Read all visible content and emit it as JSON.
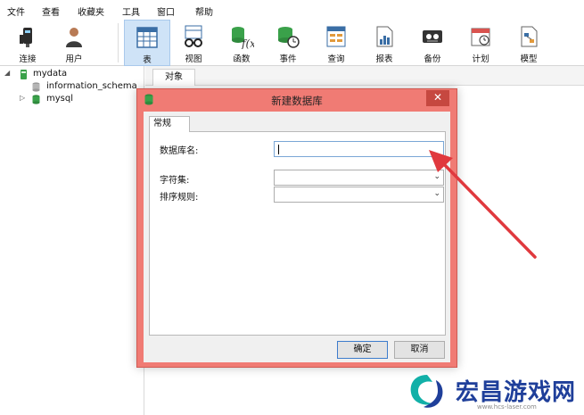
{
  "menu": [
    "文件",
    "查看",
    "收藏夹",
    "工具",
    "窗口",
    "帮助"
  ],
  "toolbar": [
    {
      "label": "连接",
      "icon": "connection-icon"
    },
    {
      "label": "用户",
      "icon": "user-icon"
    },
    {
      "label": "表",
      "icon": "table-icon",
      "active": true
    },
    {
      "label": "视图",
      "icon": "view-icon"
    },
    {
      "label": "函数",
      "icon": "function-icon"
    },
    {
      "label": "事件",
      "icon": "event-icon"
    },
    {
      "label": "查询",
      "icon": "query-icon"
    },
    {
      "label": "报表",
      "icon": "report-icon"
    },
    {
      "label": "备份",
      "icon": "backup-icon"
    },
    {
      "label": "计划",
      "icon": "schedule-icon"
    },
    {
      "label": "模型",
      "icon": "model-icon"
    }
  ],
  "tree": {
    "connection": "mydata",
    "databases": [
      "information_schema",
      "mysql"
    ]
  },
  "objects_tab": "对象",
  "dialog": {
    "title": "新建数据库",
    "close_glyph": "✕",
    "tab": "常规",
    "fields": {
      "db_name_label": "数据库名:",
      "db_name_value": "",
      "charset_label": "字符集:",
      "charset_value": "",
      "collation_label": "排序规则:",
      "collation_value": ""
    },
    "ok": "确定",
    "cancel": "取消"
  },
  "colors": {
    "dialog_frame": "#f07b74",
    "annotation_arrow": "#e0393e",
    "db_icon": "#3aa14a",
    "toolbar_active": "#cfe3f7"
  },
  "watermark": {
    "text": "宏昌游戏网",
    "url": "www.hcs-laser.com"
  }
}
